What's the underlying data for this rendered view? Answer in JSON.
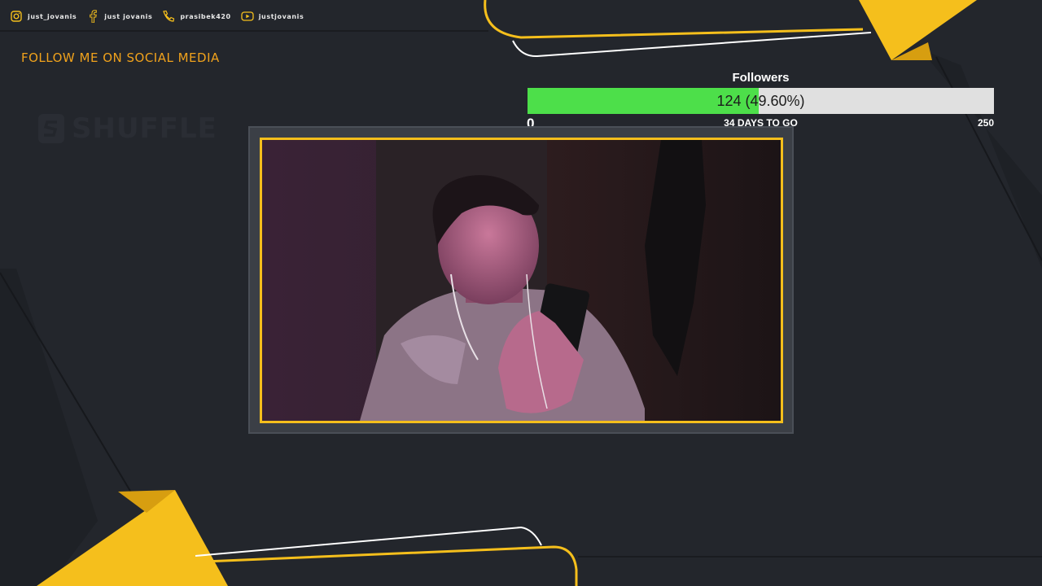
{
  "social": [
    {
      "icon": "instagram-icon",
      "handle": "just_jovanis"
    },
    {
      "icon": "facebook-icon",
      "handle": "just jovanis"
    },
    {
      "icon": "phone-icon",
      "handle": "prasibek420"
    },
    {
      "icon": "youtube-icon",
      "handle": "justjovanis"
    }
  ],
  "follow_title": "FOLLOW ME ON SOCIAL MEDIA",
  "sponsor_logo": "SHUFFLE",
  "goal": {
    "title": "Followers",
    "current": 124,
    "percent": 49.6,
    "value_text": "124 (49.60%)",
    "min": "0",
    "max": "250",
    "days_left": "34 DAYS TO GO"
  },
  "colors": {
    "background": "#23262c",
    "accent_yellow": "#f5bf1c",
    "accent_orange": "#f0a21c",
    "progress_fill": "#4ddf4a",
    "progress_track": "#e0e0e0"
  }
}
